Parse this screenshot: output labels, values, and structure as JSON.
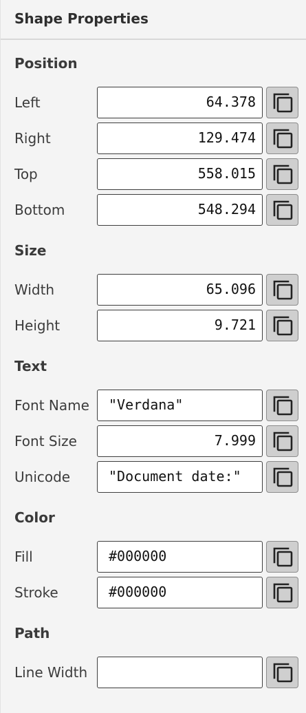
{
  "panel": {
    "title": "Shape Properties"
  },
  "sections": {
    "position": {
      "title": "Position",
      "rows": [
        {
          "label": "Left",
          "value": "64.378"
        },
        {
          "label": "Right",
          "value": "129.474"
        },
        {
          "label": "Top",
          "value": "558.015"
        },
        {
          "label": "Bottom",
          "value": "548.294"
        }
      ]
    },
    "size": {
      "title": "Size",
      "rows": [
        {
          "label": "Width",
          "value": "65.096"
        },
        {
          "label": "Height",
          "value": "9.721"
        }
      ]
    },
    "text": {
      "title": "Text",
      "rows": [
        {
          "label": "Font Name",
          "value": "\"Verdana\""
        },
        {
          "label": "Font Size",
          "value": "7.999"
        },
        {
          "label": "Unicode",
          "value": "\"Document date:\""
        }
      ]
    },
    "color": {
      "title": "Color",
      "rows": [
        {
          "label": "Fill",
          "value": "#000000"
        },
        {
          "label": "Stroke",
          "value": "#000000"
        }
      ]
    },
    "path": {
      "title": "Path",
      "rows": [
        {
          "label": "Line Width",
          "value": ""
        }
      ]
    }
  },
  "icons": {
    "copy": "copy-icon"
  },
  "colors": {
    "panel_bg": "#f4f4f4",
    "field_bg": "#ffffff",
    "button_bg": "#cfcfcf",
    "text": "#333333"
  }
}
